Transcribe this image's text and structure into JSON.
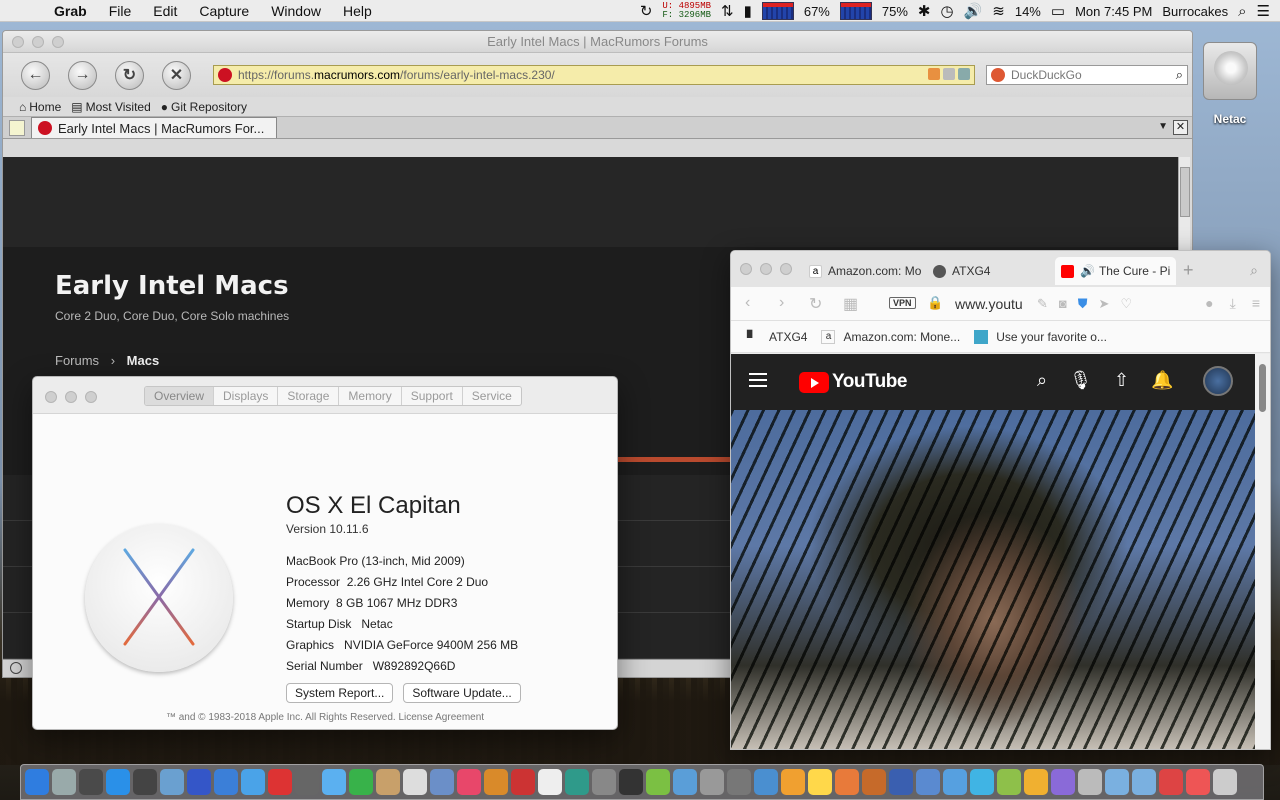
{
  "menubar": {
    "app": "Grab",
    "items": [
      "File",
      "Edit",
      "Capture",
      "Window",
      "Help"
    ],
    "mem_used": "U: 4895MB",
    "mem_free": "F: 3296MB",
    "cpu1": "67%",
    "cpu2": "75%",
    "battery": "14%",
    "clock": "Mon 7:45 PM",
    "user": "Burrocakes"
  },
  "browser": {
    "window_title": "Early Intel Macs | MacRumors Forums",
    "url_prefix": "https://forums.",
    "url_host": "macrumors.com",
    "url_path": "/forums/early-intel-macs.230/",
    "search_placeholder": "DuckDuckGo",
    "bookmarks": [
      "Home",
      "Most Visited",
      "Git Repository"
    ],
    "tab_title": "Early Intel Macs | MacRumors For...",
    "page": {
      "heading": "Early Intel Macs",
      "subheading": "Core 2 Duo, Core Duo, Core Solo machines",
      "crumb_parent": "Forums",
      "crumb_sep": "›",
      "crumb_current": "Macs"
    }
  },
  "about": {
    "tabs": [
      "Overview",
      "Displays",
      "Storage",
      "Memory",
      "Support",
      "Service"
    ],
    "os_name_bold": "OS X",
    "os_name_light": "El Capitan",
    "version": "Version 10.11.6",
    "model": "MacBook Pro (13-inch, Mid 2009)",
    "specs": [
      {
        "key": "Processor",
        "value": "2.26 GHz Intel Core 2 Duo"
      },
      {
        "key": "Memory",
        "value": "8 GB 1067 MHz DDR3"
      },
      {
        "key": "Startup Disk",
        "value": "Netac"
      },
      {
        "key": "Graphics",
        "value": "NVIDIA GeForce 9400M 256 MB"
      },
      {
        "key": "Serial Number",
        "value": "W892892Q66D"
      }
    ],
    "btn_report": "System Report...",
    "btn_update": "Software Update...",
    "footer": "™ and © 1983-2018 Apple Inc. All Rights Reserved. License Agreement"
  },
  "yt_browser": {
    "tabs": [
      "Amazon.com: Mo",
      "ATXG4",
      "The Cure - Pi"
    ],
    "vpn": "VPN",
    "url": "www.youtube.com",
    "bookmarks": [
      "ATXG4",
      "Amazon.com: Mone...",
      "Use your favorite o..."
    ],
    "brand": "YouTube"
  },
  "desktop": {
    "drive_label": "Netac"
  }
}
